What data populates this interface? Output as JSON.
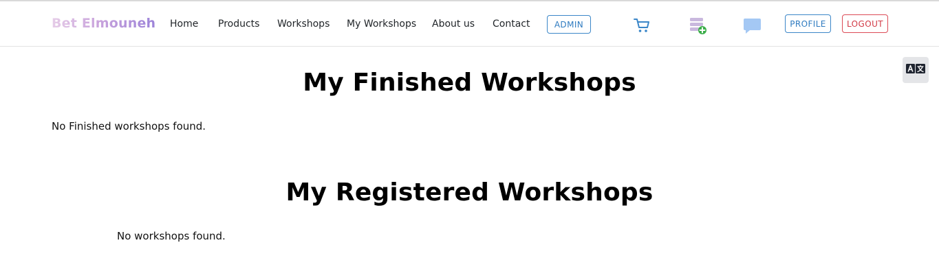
{
  "navbar": {
    "brand": "Bet Elmouneh",
    "links": [
      "Home",
      "Products",
      "Workshops",
      "My Workshops",
      "About us",
      "Contact"
    ],
    "admin_label": "ADMIN",
    "profile_label": "PROFILE",
    "logout_label": "LOGOUT",
    "icons": [
      "cart-icon",
      "add-to-list-icon",
      "chat-icon"
    ]
  },
  "translate": {
    "icon": "translate-icon"
  },
  "sections": {
    "finished": {
      "title": "My Finished Workshops",
      "empty_message": "No Finished workshops found."
    },
    "registered": {
      "title": "My Registered Workshops",
      "empty_message": "No workshops found."
    }
  },
  "colors": {
    "primary": "#3a86c8",
    "danger": "#dc4a55",
    "brand_gradient_start": "#e6cde8",
    "brand_gradient_end": "#9d84d9"
  }
}
